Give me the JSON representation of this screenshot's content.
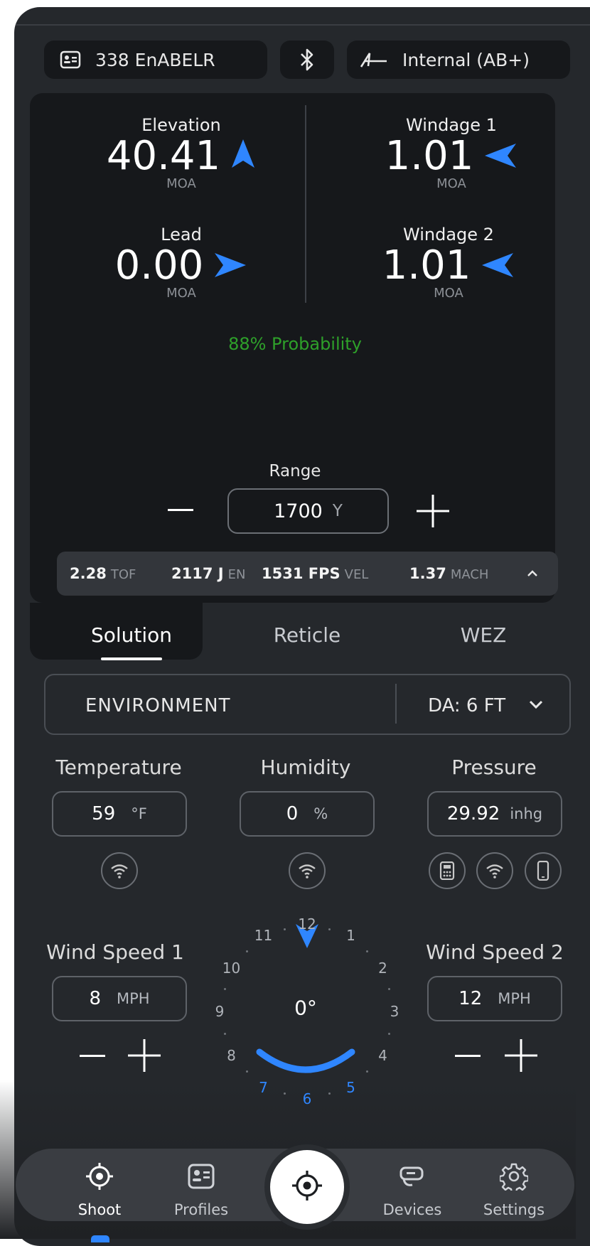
{
  "header": {
    "profile_label": "338 EnABELR",
    "ballistics_label": "Internal (AB+)"
  },
  "solution": {
    "elevation": {
      "label": "Elevation",
      "value": "40.41",
      "unit": "MOA"
    },
    "windage1": {
      "label": "Windage 1",
      "value": "1.01",
      "unit": "MOA"
    },
    "lead": {
      "label": "Lead",
      "value": "0.00",
      "unit": "MOA"
    },
    "windage2": {
      "label": "Windage 2",
      "value": "1.01",
      "unit": "MOA"
    },
    "probability": "88% Probability",
    "colors": {
      "accent": "#2f86ff",
      "probability": "#2ea02a"
    }
  },
  "range": {
    "label": "Range",
    "value": "1700",
    "unit": "Y"
  },
  "stats": [
    {
      "value": "2.28",
      "key": "TOF"
    },
    {
      "value": "2117 J",
      "key": "EN"
    },
    {
      "value": "1531 FPS",
      "key": "VEL"
    },
    {
      "value": "1.37",
      "key": "MACH"
    }
  ],
  "tabs": [
    "Solution",
    "Reticle",
    "WEZ"
  ],
  "environment": {
    "title": "ENVIRONMENT",
    "da": "DA: 6 FT"
  },
  "temperature": {
    "label": "Temperature",
    "value": "59",
    "unit": "°F"
  },
  "humidity": {
    "label": "Humidity",
    "value": "0",
    "unit": "%"
  },
  "pressure": {
    "label": "Pressure",
    "value": "29.92",
    "unit": "inhg"
  },
  "wind1": {
    "label": "Wind Speed 1",
    "value": "8",
    "unit": "MPH"
  },
  "wind2": {
    "label": "Wind Speed 2",
    "value": "12",
    "unit": "MPH"
  },
  "dial": {
    "direction": "0°",
    "hours": [
      "12",
      "1",
      "2",
      "3",
      "4",
      "5",
      "6",
      "7",
      "8",
      "9",
      "10",
      "11"
    ]
  },
  "nav": {
    "shoot": "Shoot",
    "profiles": "Profiles",
    "devices": "Devices",
    "settings": "Settings"
  }
}
